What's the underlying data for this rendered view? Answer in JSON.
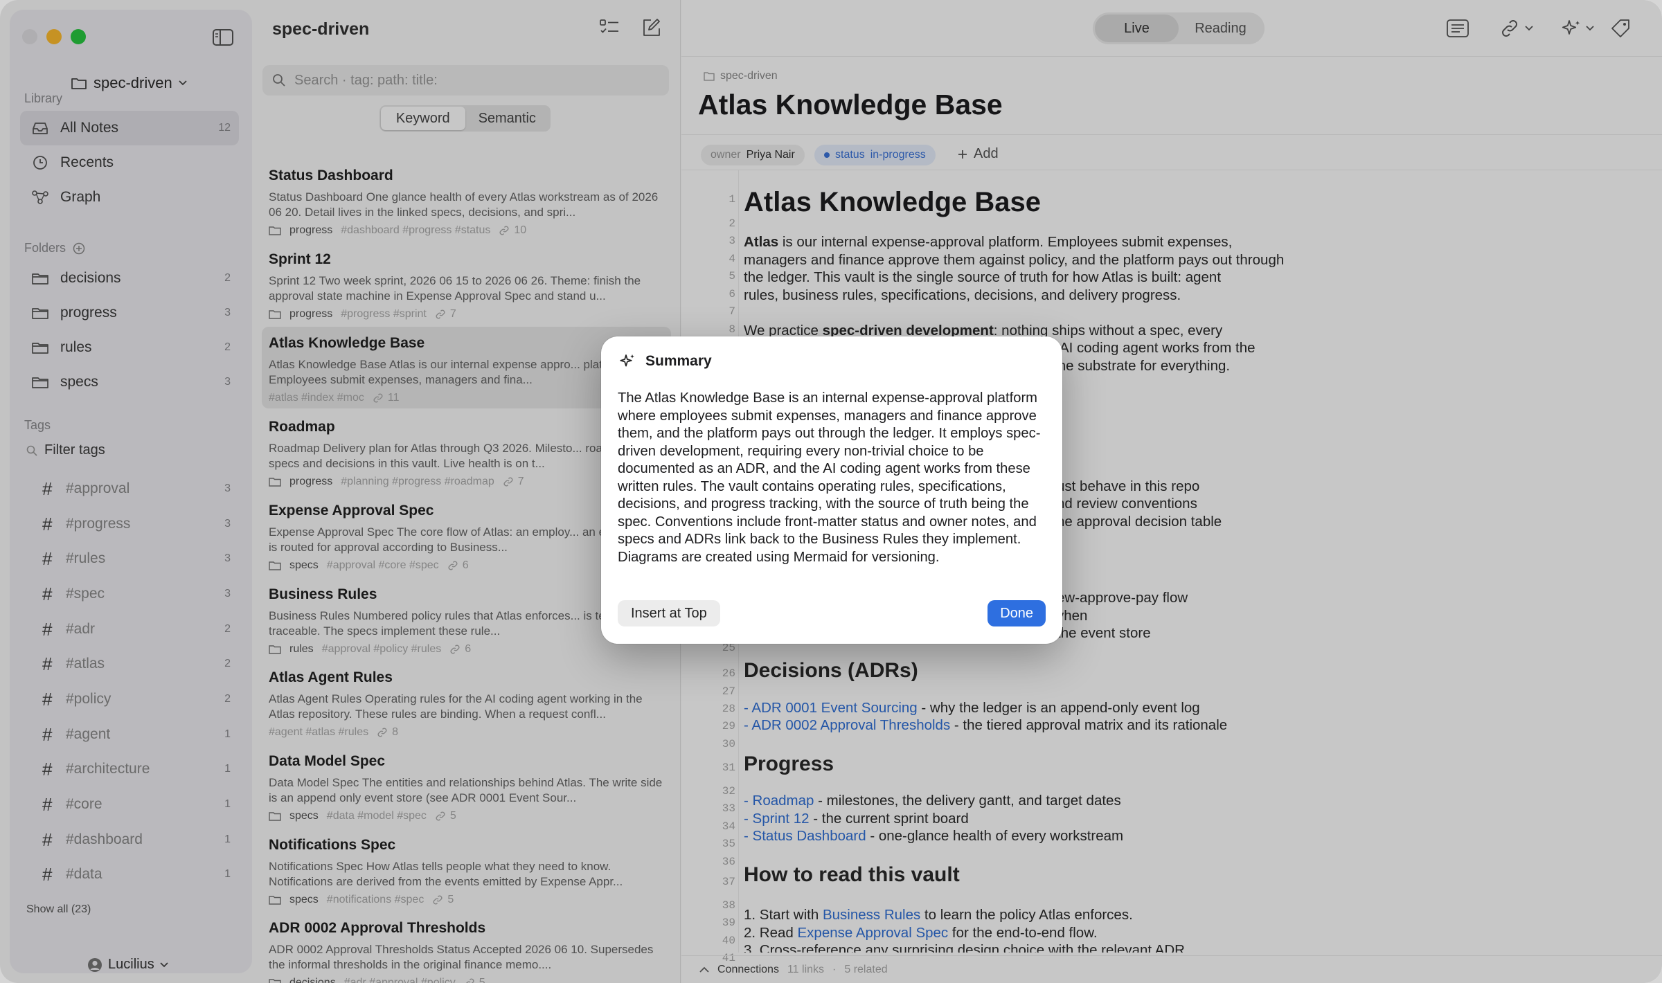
{
  "window": {
    "traffic_colors": [
      "#ff5f57",
      "#febc2e",
      "#28c840"
    ]
  },
  "sidebar": {
    "vault_name": "spec-driven",
    "library_heading": "Library",
    "nav": [
      {
        "label": "All Notes",
        "count": "12"
      },
      {
        "label": "Recents"
      },
      {
        "label": "Graph"
      }
    ],
    "folders_heading": "Folders",
    "folders": [
      {
        "label": "decisions",
        "count": "2"
      },
      {
        "label": "progress",
        "count": "3"
      },
      {
        "label": "rules",
        "count": "2"
      },
      {
        "label": "specs",
        "count": "3"
      }
    ],
    "tags_heading": "Tags",
    "filter_placeholder": "Filter tags",
    "tags": [
      {
        "label": "#approval",
        "count": "3"
      },
      {
        "label": "#progress",
        "count": "3"
      },
      {
        "label": "#rules",
        "count": "3"
      },
      {
        "label": "#spec",
        "count": "3"
      },
      {
        "label": "#adr",
        "count": "2"
      },
      {
        "label": "#atlas",
        "count": "2"
      },
      {
        "label": "#policy",
        "count": "2"
      },
      {
        "label": "#agent",
        "count": "1"
      },
      {
        "label": "#architecture",
        "count": "1"
      },
      {
        "label": "#core",
        "count": "1"
      },
      {
        "label": "#dashboard",
        "count": "1"
      },
      {
        "label": "#data",
        "count": "1"
      }
    ],
    "show_all": "Show all (23)",
    "user": "Lucilius"
  },
  "notelist": {
    "title": "spec-driven",
    "search_placeholder": "Search  ·  tag: path: title:",
    "search_modes": [
      "Keyword",
      "Semantic"
    ],
    "notes": [
      {
        "title": "Status Dashboard",
        "snippet": "Status Dashboard One glance health of every Atlas workstream as of 2026 06 20. Detail lives in the linked specs, decisions, and spri...",
        "folder": "progress",
        "tags": "#dashboard #progress #status",
        "links": "10"
      },
      {
        "title": "Sprint 12",
        "snippet": "Sprint 12 Two week sprint, 2026 06 15 to 2026 06 26. Theme: finish the approval state machine in Expense Approval Spec and stand u...",
        "folder": "progress",
        "tags": "#progress #sprint",
        "links": "7"
      },
      {
        "title": "Atlas Knowledge Base",
        "snippet": "Atlas Knowledge Base Atlas is our internal expense appro... platform. Employees submit expenses, managers and fina...",
        "folder": "",
        "tags": "#atlas #index #moc",
        "links": "11"
      },
      {
        "title": "Roadmap",
        "snippet": "Roadmap Delivery plan for Atlas through Q3 2026. Milesto... roadmap specs and decisions in this vault. Live health is on t...",
        "folder": "progress",
        "tags": "#planning #progress #roadmap",
        "links": "7"
      },
      {
        "title": "Expense Approval Spec",
        "snippet": "Expense Approval Spec The core flow of Atlas: an employ... an expense, it is routed for approval according to Business...",
        "folder": "specs",
        "tags": "#approval #core #spec",
        "links": "6"
      },
      {
        "title": "Business Rules",
        "snippet": "Business Rules Numbered policy rules that Atlas enforces... is testable and traceable. The specs implement these rule...",
        "folder": "rules",
        "tags": "#approval #policy #rules",
        "links": "6"
      },
      {
        "title": "Atlas Agent Rules",
        "snippet": "Atlas Agent Rules Operating rules for the AI coding agent working in the Atlas repository. These rules are binding. When a request confl...",
        "folder": "",
        "tags": "#agent #atlas #rules",
        "links": "8"
      },
      {
        "title": "Data Model Spec",
        "snippet": "Data Model Spec The entities and relationships behind Atlas. The write side is an append only event store (see ADR 0001 Event Sour...",
        "folder": "specs",
        "tags": "#data #model #spec",
        "links": "5"
      },
      {
        "title": "Notifications Spec",
        "snippet": "Notifications Spec How Atlas tells people what they need to know. Notifications are derived from the events emitted by Expense Appr...",
        "folder": "specs",
        "tags": "#notifications #spec",
        "links": "5"
      },
      {
        "title": "ADR 0002 Approval Thresholds",
        "snippet": "ADR 0002 Approval Thresholds Status Accepted 2026 06 10. Supersedes the informal thresholds in the original finance memo....",
        "folder": "decisions",
        "tags": "#adr #approval #policy",
        "links": "5"
      }
    ]
  },
  "editor": {
    "modes": [
      "Live",
      "Reading"
    ],
    "breadcrumb": "spec-driven",
    "title": "Atlas Knowledge Base",
    "properties": [
      {
        "key": "owner",
        "value": "Priya Nair"
      },
      {
        "key": "status",
        "value": "in-progress"
      }
    ],
    "add_property": "Add",
    "line_numbers": [
      "1",
      "2",
      "3",
      "4",
      "5",
      "6",
      "7",
      "8",
      "25",
      "26",
      "27",
      "28",
      "29",
      "30",
      "31",
      "32",
      "33",
      "34",
      "35",
      "36",
      "37",
      "38",
      "39",
      "40",
      "41"
    ],
    "lines": {
      "h1": "Atlas Knowledge Base",
      "p1a_bold": "Atlas",
      "p1a": " is our internal expense-approval platform. Employees submit expenses,",
      "p1b": "managers and finance approve them against policy, and the platform pays out through",
      "p1c": "the ledger. This vault is the single source of truth for how Atlas is built: agent",
      "p1d": "rules, business rules, specifications, decisions, and delivery progress.",
      "p2a_pre": "We practice ",
      "p2a_bold": "spec-driven development",
      "p2a_post": ": nothing ships without a spec, every",
      "p2b": "e AI coding agent works from the",
      "p2c": "the substrate for everything.",
      "f1": "ust behave in this repo",
      "f2": "nd review conventions",
      "f3": "he approval decision table",
      "f4": "ew-approve-pay flow",
      "f5": "vhen",
      "f6": "the event store",
      "h2_decisions": "Decisions (ADRs)",
      "adr1_link": "ADR 0001 Event Sourcing",
      "adr1_rest": " - why the ledger is an append-only event log",
      "adr2_link": "ADR 0002 Approval Thresholds",
      "adr2_rest": " - the tiered approval matrix and its rationale",
      "h2_progress": "Progress",
      "pr1_link": "Roadmap",
      "pr1_rest": " - milestones, the delivery gantt, and target dates",
      "pr2_link": "Sprint 12",
      "pr2_rest": " - the current sprint board",
      "pr3_link": "Status Dashboard",
      "pr3_rest": " - one-glance health of every workstream",
      "h2_read": "How to read this vault",
      "r1_pre": "1. Start with ",
      "r1_link": "Business Rules",
      "r1_rest": " to learn the policy Atlas enforces.",
      "r2_pre": "2. Read ",
      "r2_link": "Expense Approval Spec",
      "r2_rest": " for the end-to-end flow.",
      "r3": "3. Cross-reference any surprising design choice with the relevant ADR."
    },
    "footer": {
      "label": "Connections",
      "links": "11 links",
      "related": "5 related"
    }
  },
  "modal": {
    "title": "Summary",
    "body": "The Atlas Knowledge Base is an internal expense-approval platform where employees submit expenses, managers and finance approve them, and the platform pays out through the ledger. It employs spec-driven development, requiring every non-trivial choice to be documented as an ADR, and the AI coding agent works from these written rules. The vault contains operating rules, specifications, decisions, and progress tracking, with the source of truth being the spec. Conventions include front-matter status and owner notes, and specs and ADRs link back to the Business Rules they implement. Diagrams are created using Mermaid for versioning.",
    "insert_label": "Insert at Top",
    "done_label": "Done"
  },
  "colors": {
    "accent": "#2e6fe0",
    "link": "#2f6fd6"
  }
}
